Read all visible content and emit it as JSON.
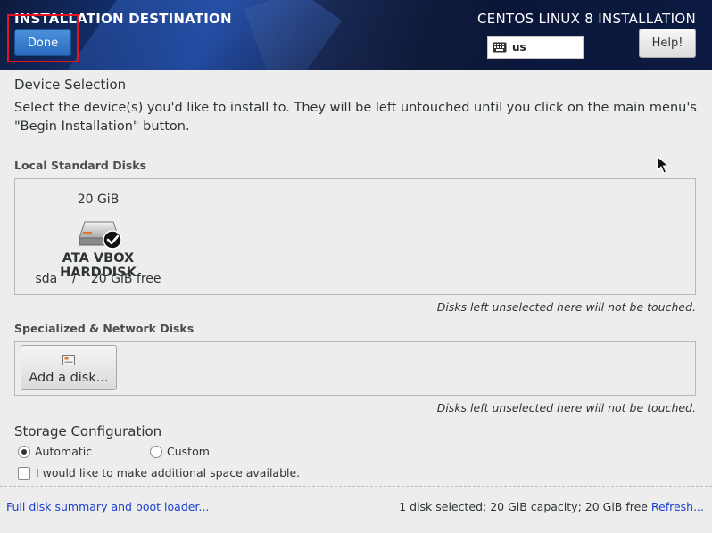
{
  "header": {
    "spoke_title": "INSTALLATION DESTINATION",
    "product_title": "CENTOS LINUX 8 INSTALLATION",
    "done_label": "Done",
    "help_label": "Help!",
    "keyboard_layout": "us",
    "keyboard_icon": "keyboard-icon"
  },
  "device_selection": {
    "title": "Device Selection",
    "description": "Select the device(s) you'd like to install to.  They will be left untouched until you click on the main menu's \"Begin Installation\" button."
  },
  "local_disks": {
    "heading": "Local Standard Disks",
    "disks": [
      {
        "size": "20 GiB",
        "name": "ATA VBOX HARDDISK",
        "device": "sda",
        "separator": "/",
        "free": "20 GiB free",
        "selected": true,
        "icon": "harddisk-icon"
      }
    ],
    "note": "Disks left unselected here will not be touched."
  },
  "specialized_disks": {
    "heading": "Specialized & Network Disks",
    "add_disk_label": "Add a disk...",
    "note": "Disks left unselected here will not be touched."
  },
  "storage_configuration": {
    "title": "Storage Configuration",
    "automatic_label": "Automatic",
    "custom_label": "Custom",
    "selected": "Automatic",
    "additional_space_label": "I would like to make additional space available.",
    "additional_space_checked": false
  },
  "footer": {
    "summary_link": "Full disk summary and boot loader...",
    "status": "1 disk selected; 20 GiB capacity; 20 GiB free",
    "refresh_link": "Refresh..."
  },
  "colors": {
    "done_button": "#2a6cc0",
    "highlight": "#e3141f",
    "link": "#1a3fcf"
  }
}
